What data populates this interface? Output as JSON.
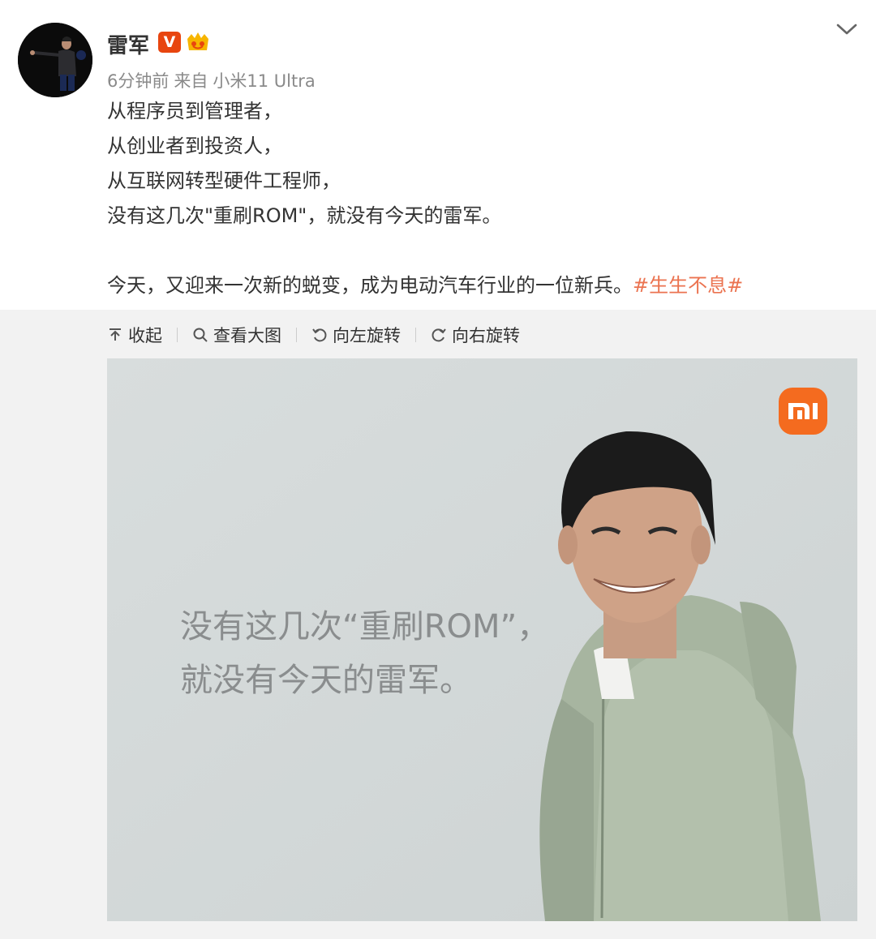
{
  "author": {
    "name": "雷军",
    "verified_label": "V",
    "meta": {
      "time": "6分钟前",
      "source_prefix": "来自",
      "device": "小米11 Ultra"
    }
  },
  "post": {
    "lines": [
      "从程序员到管理者，",
      "从创业者到投资人，",
      "从互联网转型硬件工程师，",
      "没有这几次\"重刷ROM\"，就没有今天的雷军。"
    ],
    "last_line_text": "今天，又迎来一次新的蜕变，成为电动汽车行业的一位新兵。",
    "hashtag": "#生生不息#"
  },
  "toolbar": {
    "collapse": "收起",
    "view_large": "查看大图",
    "rotate_left": "向左旋转",
    "rotate_right": "向右旋转"
  },
  "image": {
    "logo_text": "mi",
    "caption_line1": "没有这几次“重刷ROM”，",
    "caption_line2": "就没有今天的雷军。"
  },
  "colors": {
    "hashtag": "#eb7350",
    "verified_badge": "#e8450f",
    "mi_orange": "#f46b1f",
    "panel_bg": "#f2f2f2"
  },
  "icons": [
    "chevron-down-icon",
    "collapse-icon",
    "search-icon",
    "rotate-left-icon",
    "rotate-right-icon",
    "vip-crown-icon"
  ]
}
